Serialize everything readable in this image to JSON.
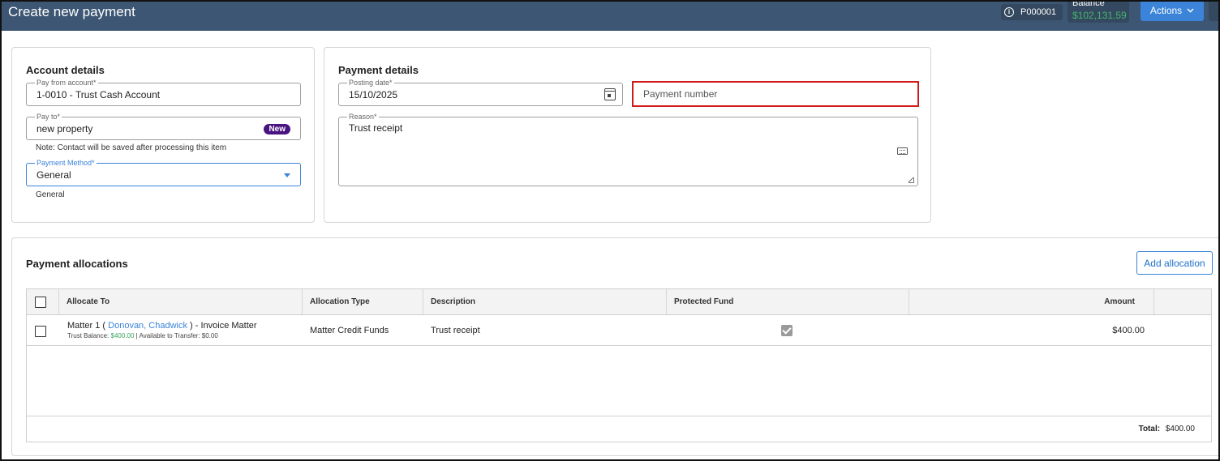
{
  "header": {
    "title": "Create new payment",
    "payment_id": "P000001",
    "balance_label": "Balance",
    "balance_value": "$102,131.59",
    "actions_label": "Actions"
  },
  "account_details": {
    "heading": "Account details",
    "pay_from_label": "Pay from account*",
    "pay_from_value": "1-0010 - Trust Cash Account",
    "pay_to_label": "Pay to*",
    "pay_to_value": "new property",
    "pay_to_badge": "New",
    "note": "Note: Contact will be saved after processing this item",
    "payment_method_label": "Payment Method*",
    "payment_method_value": "General",
    "payment_method_option": "General"
  },
  "payment_details": {
    "heading": "Payment details",
    "posting_date_label": "Posting date*",
    "posting_date_value": "15/10/2025",
    "payment_number_placeholder": "Payment number",
    "reason_label": "Reason*",
    "reason_value": "Trust receipt"
  },
  "allocations": {
    "heading": "Payment allocations",
    "add_button": "Add allocation",
    "columns": [
      "Allocate To",
      "Allocation Type",
      "Description",
      "Protected Fund",
      "Amount"
    ],
    "rows": [
      {
        "allocate_prefix": "Matter 1 (",
        "allocate_link": "Donovan, Chadwick",
        "allocate_suffix": ") - Invoice Matter",
        "trust_balance_label": "Trust Balance:",
        "trust_balance_value": "$400.00",
        "available_label": "| Available to Transfer: $0.00",
        "allocation_type": "Matter Credit Funds",
        "description": "Trust receipt",
        "protected_fund": true,
        "amount": "$400.00"
      }
    ],
    "total_label": "Total:",
    "total_value": "$400.00"
  },
  "colors": {
    "header_bg": "#3d5674",
    "accent": "#3b84d9",
    "badge": "#4a1480",
    "highlight_border": "#d11a1a",
    "positive": "#3aa55c"
  }
}
